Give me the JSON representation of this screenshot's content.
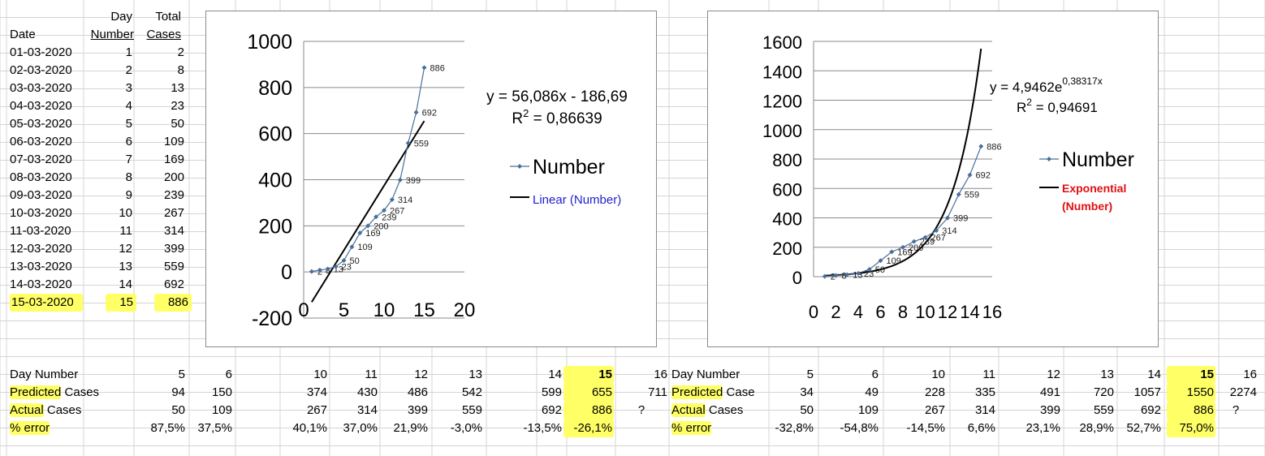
{
  "left_table": {
    "head1": [
      "",
      "Day",
      "Total"
    ],
    "head2": [
      "Date",
      "Number",
      "Cases"
    ],
    "rows": [
      [
        "01-03-2020",
        "1",
        "2"
      ],
      [
        "02-03-2020",
        "2",
        "8"
      ],
      [
        "03-03-2020",
        "3",
        "13"
      ],
      [
        "04-03-2020",
        "4",
        "23"
      ],
      [
        "05-03-2020",
        "5",
        "50"
      ],
      [
        "06-03-2020",
        "6",
        "109"
      ],
      [
        "07-03-2020",
        "7",
        "169"
      ],
      [
        "08-03-2020",
        "8",
        "200"
      ],
      [
        "09-03-2020",
        "9",
        "239"
      ],
      [
        "10-03-2020",
        "10",
        "267"
      ],
      [
        "11-03-2020",
        "11",
        "314"
      ],
      [
        "12-03-2020",
        "12",
        "399"
      ],
      [
        "13-03-2020",
        "13",
        "559"
      ],
      [
        "14-03-2020",
        "14",
        "692"
      ],
      [
        "15-03-2020",
        "15",
        "886"
      ]
    ]
  },
  "bottom_left": {
    "labels": [
      "Day Number",
      "Predicted Cases",
      "Actual Cases",
      "% error"
    ],
    "cols": [
      [
        "5",
        "94",
        "50",
        "87,5%"
      ],
      [
        "6",
        "150",
        "109",
        "37,5%"
      ],
      [
        "10",
        "374",
        "267",
        "40,1%"
      ],
      [
        "11",
        "430",
        "314",
        "37,0%"
      ],
      [
        "12",
        "486",
        "399",
        "21,9%"
      ],
      [
        "13",
        "542",
        "559",
        "-3,0%"
      ],
      [
        "14",
        "599",
        "692",
        "-13,5%"
      ],
      [
        "15",
        "655",
        "886",
        "-26,1%"
      ],
      [
        "16",
        "711",
        "?",
        ""
      ]
    ]
  },
  "bottom_right": {
    "labels": [
      "Day Number",
      "Predicted Case",
      "Actual Cases",
      "% error"
    ],
    "cols": [
      [
        "5",
        "34",
        "50",
        "-32,8%"
      ],
      [
        "6",
        "49",
        "109",
        "-54,8%"
      ],
      [
        "10",
        "228",
        "267",
        "-14,5%"
      ],
      [
        "11",
        "335",
        "314",
        "6,6%"
      ],
      [
        "12",
        "491",
        "399",
        "23,1%"
      ],
      [
        "13",
        "720",
        "559",
        "28,9%"
      ],
      [
        "14",
        "1057",
        "692",
        "52,7%"
      ],
      [
        "15",
        "1550",
        "886",
        "75,0%"
      ],
      [
        "16",
        "2274",
        "?",
        ""
      ]
    ]
  },
  "colors": {
    "highlight": "#ffff66",
    "series": "#4a6f9c",
    "trend": "#000000",
    "legend_linear": "#1f1fcc",
    "legend_exp": "#e01010",
    "gridline": "#d4d4d4"
  },
  "chart_data": [
    {
      "type": "scatter",
      "x": [
        1,
        2,
        3,
        4,
        5,
        6,
        7,
        8,
        9,
        10,
        11,
        12,
        13,
        14,
        15
      ],
      "values": [
        2,
        8,
        13,
        23,
        50,
        109,
        169,
        200,
        239,
        267,
        314,
        399,
        559,
        692,
        886
      ],
      "point_labels": [
        "2",
        "8",
        "13",
        "23",
        "50",
        "109",
        "169",
        "200",
        "239",
        "267",
        "314",
        "399",
        "559",
        "692",
        "886"
      ],
      "xlim": [
        0,
        20
      ],
      "ylim": [
        -200,
        1000
      ],
      "xticks": [
        "0",
        "5",
        "10",
        "15",
        "20"
      ],
      "yticks": [
        "-200",
        "0",
        "200",
        "400",
        "600",
        "800",
        "1000"
      ],
      "trend": {
        "kind": "linear",
        "slope": 56.086,
        "intercept": -186.69,
        "x_range": [
          1,
          15
        ]
      },
      "equation": "y = 56,086x - 186,69",
      "r2_prefix": "R",
      "r2_sup": "2",
      "r2_value": " = 0,86639",
      "legend": {
        "series": "Number",
        "trend": "Linear (Number)",
        "position": "right"
      }
    },
    {
      "type": "scatter",
      "x": [
        1,
        2,
        3,
        4,
        5,
        6,
        7,
        8,
        9,
        10,
        11,
        12,
        13,
        14,
        15
      ],
      "values": [
        2,
        8,
        13,
        23,
        50,
        109,
        169,
        200,
        239,
        267,
        314,
        399,
        559,
        692,
        886
      ],
      "point_labels": [
        "2",
        "8",
        "13",
        "23",
        "50",
        "109",
        "169",
        "200",
        "239",
        "267",
        "314",
        "399",
        "559",
        "692",
        "886"
      ],
      "xlim": [
        0,
        16
      ],
      "ylim": [
        0,
        1600
      ],
      "xticks": [
        "0",
        "2",
        "4",
        "6",
        "8",
        "10",
        "12",
        "14",
        "16"
      ],
      "yticks": [
        "0",
        "200",
        "400",
        "600",
        "800",
        "1000",
        "1200",
        "1400",
        "1600"
      ],
      "trend": {
        "kind": "exponential",
        "a": 4.9462,
        "b": 0.38317,
        "x_range": [
          1,
          15
        ]
      },
      "equation": "y = 4,9462e",
      "equation_sup": "0,38317x",
      "r2_prefix": "R",
      "r2_sup": "2",
      "r2_value": " = 0,94691",
      "legend": {
        "series": "Number",
        "trend1": "Exponential",
        "trend2": "(Number)",
        "position": "right"
      }
    }
  ]
}
